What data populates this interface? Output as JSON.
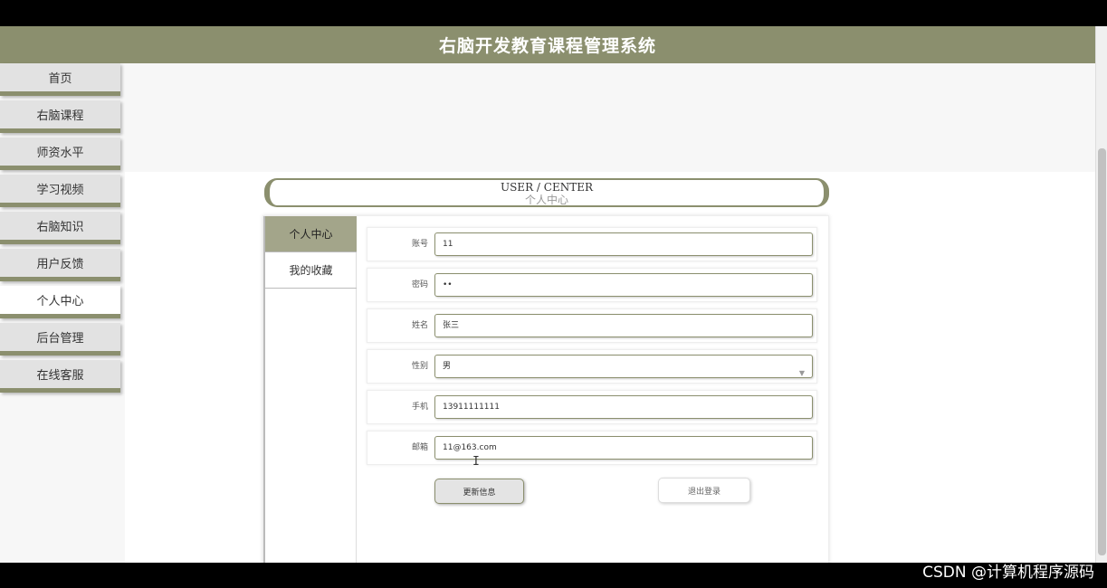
{
  "header": {
    "title": "右脑开发教育课程管理系统"
  },
  "sidebar": {
    "items": [
      {
        "label": "首页"
      },
      {
        "label": "右脑课程"
      },
      {
        "label": "师资水平"
      },
      {
        "label": "学习视频"
      },
      {
        "label": "右脑知识"
      },
      {
        "label": "用户反馈"
      },
      {
        "label": "个人中心",
        "active": true
      },
      {
        "label": "后台管理"
      },
      {
        "label": "在线客服"
      }
    ]
  },
  "section_title": {
    "en": "USER / CENTER",
    "cn": "个人中心"
  },
  "tabs": [
    {
      "label": "个人中心",
      "active": true
    },
    {
      "label": "我的收藏"
    }
  ],
  "form": {
    "account": {
      "label": "账号",
      "value": "11"
    },
    "password": {
      "label": "密码",
      "value": "••"
    },
    "name": {
      "label": "姓名",
      "value": "张三"
    },
    "gender": {
      "label": "性别",
      "value": "男"
    },
    "phone": {
      "label": "手机",
      "value": "13911111111"
    },
    "email": {
      "label": "邮箱",
      "value": "11@163.com"
    }
  },
  "buttons": {
    "update": "更新信息",
    "logout": "退出登录"
  },
  "watermark": "CSDN @计算机程序源码",
  "colors": {
    "accent": "#8b8f6e",
    "tab_active": "#a3a58a"
  },
  "icons": {
    "select_caret": "chevron-down-icon",
    "text_cursor": "text-cursor-icon"
  }
}
